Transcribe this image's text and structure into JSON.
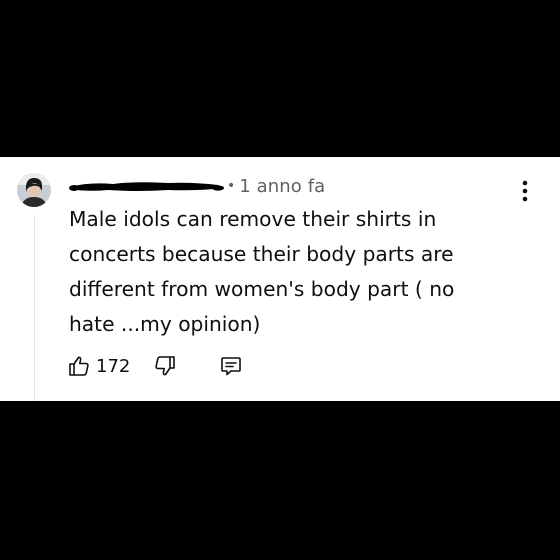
{
  "comment": {
    "author_redacted": true,
    "timestamp": "1 anno fa",
    "text": "Male idols can remove their shirts in\nconcerts  because their body parts are\ndifferent from women's body part ( no\nhate ...my opinion)",
    "like_count": "172"
  },
  "icons": {
    "like": "thumbs-up-icon",
    "dislike": "thumbs-down-icon",
    "reply": "comment-bubble-icon",
    "menu": "more-vertical-icon"
  },
  "colors": {
    "background": "#000000",
    "card": "#ffffff",
    "text": "#0f0f0f",
    "meta": "#606060"
  }
}
